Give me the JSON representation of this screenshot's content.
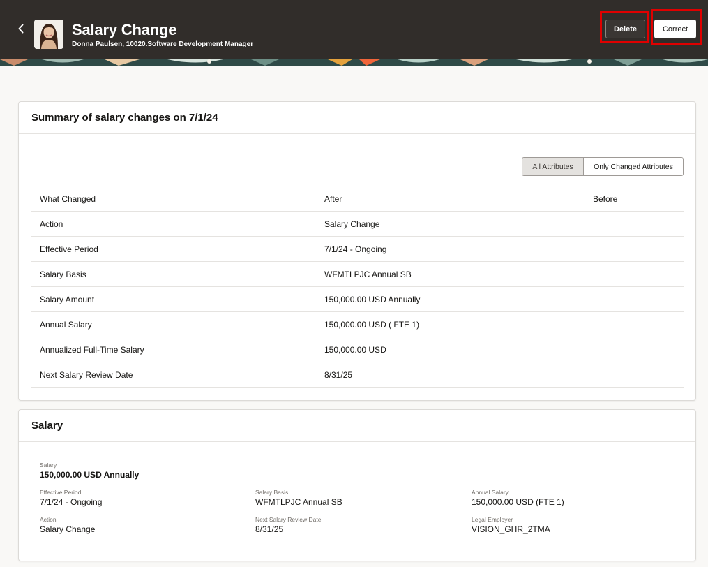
{
  "header": {
    "title": "Salary Change",
    "subtitle": "Donna Paulsen, 10020.Software Development Manager",
    "delete_label": "Delete",
    "correct_label": "Correct"
  },
  "summary": {
    "title": "Summary of salary changes on 7/1/24",
    "toggle": {
      "all_label": "All Attributes",
      "changed_label": "Only Changed Attributes",
      "selected": "All Attributes"
    },
    "columns": [
      "What Changed",
      "After",
      "Before"
    ],
    "rows": [
      {
        "what": "Action",
        "after": "Salary Change",
        "before": ""
      },
      {
        "what": "Effective Period",
        "after": "7/1/24 - Ongoing",
        "before": ""
      },
      {
        "what": "Salary Basis",
        "after": "WFMTLPJC Annual SB",
        "before": ""
      },
      {
        "what": "Salary Amount",
        "after": "150,000.00 USD Annually",
        "before": ""
      },
      {
        "what": "Annual Salary",
        "after": "150,000.00 USD ( FTE 1)",
        "before": ""
      },
      {
        "what": "Annualized Full-Time Salary",
        "after": "150,000.00 USD",
        "before": ""
      },
      {
        "what": "Next Salary Review Date",
        "after": "8/31/25",
        "before": ""
      }
    ]
  },
  "salary": {
    "title": "Salary",
    "salary": {
      "label": "Salary",
      "value": "150,000.00 USD Annually"
    },
    "effective_period": {
      "label": "Effective Period",
      "value": "7/1/24 - Ongoing"
    },
    "salary_basis": {
      "label": "Salary Basis",
      "value": "WFMTLPJC Annual SB"
    },
    "annual_salary": {
      "label": "Annual Salary",
      "value": "150,000.00 USD (FTE 1)"
    },
    "action": {
      "label": "Action",
      "value": "Salary Change"
    },
    "next_review": {
      "label": "Next Salary Review Date",
      "value": "8/31/25"
    },
    "legal_employer": {
      "label": "Legal Employer",
      "value": "VISION_GHR_2TMA"
    }
  },
  "colors": {
    "header_bg": "#312d2a",
    "highlight": "#e00000",
    "page_bg": "#f9f8f6"
  },
  "icons": {
    "back": "chevron-left-icon",
    "avatar": "person-photo-icon"
  }
}
